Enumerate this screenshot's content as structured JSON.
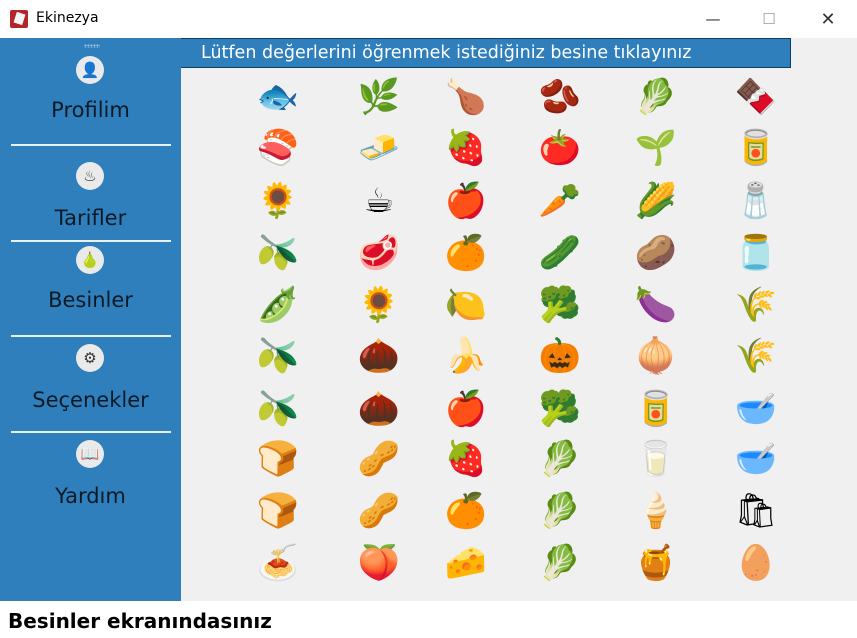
{
  "window": {
    "title": "Ekinezya",
    "minimize": "—",
    "maximize": "☐",
    "close": "✕"
  },
  "sidebar": {
    "items": [
      {
        "label": "Profilim",
        "icon": "👤"
      },
      {
        "label": "Tarifler",
        "icon": "♨"
      },
      {
        "label": "Besinler",
        "icon": "🍐"
      },
      {
        "label": "Seçenekler",
        "icon": "⚙"
      },
      {
        "label": "Yardım",
        "icon": "📖"
      }
    ]
  },
  "header": {
    "text": "Lütfen değerlerini öğrenmek istediğiniz besine tıklayınız"
  },
  "foods": [
    [
      "🐟",
      "🌿",
      "🍗",
      "🫘",
      "🥬",
      "🍫"
    ],
    [
      "🍣",
      "🧈",
      "🍓",
      "🍅",
      "🌱",
      "🥫"
    ],
    [
      "🌻",
      "☕",
      "🍎",
      "🥕",
      "🌽",
      "🧂"
    ],
    [
      "🫒",
      "🥩",
      "🍊",
      "🥒",
      "🥔",
      "🫙"
    ],
    [
      "🫛",
      "🌻",
      "🍋",
      "🥦",
      "🍆",
      "🌾"
    ],
    [
      "🫒",
      "🌰",
      "🍌",
      "🎃",
      "🧅",
      "🌾"
    ],
    [
      "🫒",
      "🌰",
      "🍎",
      "🥦",
      "🥫",
      "🥣"
    ],
    [
      "🍞",
      "🥜",
      "🍓",
      "🥬",
      "🥛",
      "🥣"
    ],
    [
      "🍞",
      "🥜",
      "🍊",
      "🥬",
      "🍦",
      "🛍"
    ],
    [
      "🍝",
      "🍑",
      "🧀",
      "🥬",
      "🍯",
      "🥚"
    ]
  ],
  "status": {
    "text": "Besinler ekranındasınız"
  }
}
